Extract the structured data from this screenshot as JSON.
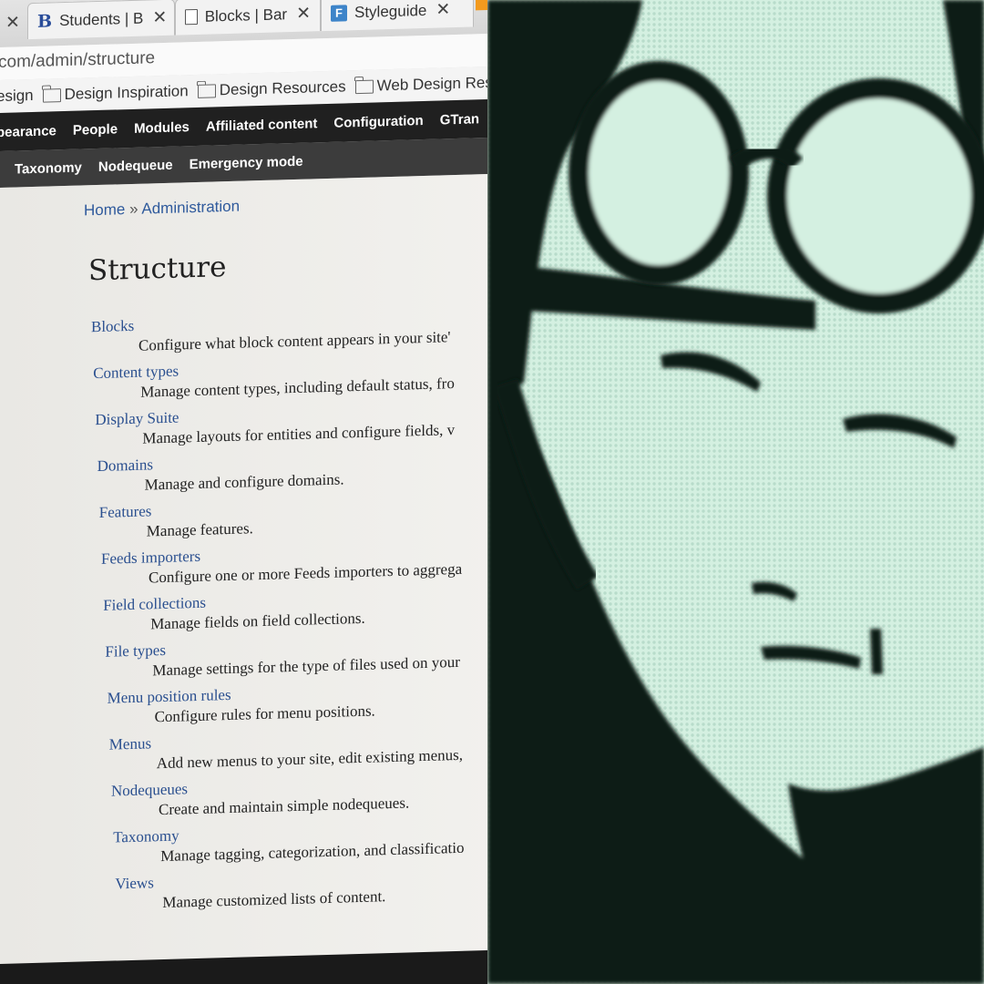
{
  "browser": {
    "tabs": [
      {
        "icon": "b-favicon",
        "label": "Students | B"
      },
      {
        "icon": "document-icon",
        "label": "Blocks | Bar"
      },
      {
        "icon": "styleguide-favicon",
        "label": "Styleguide"
      }
    ],
    "url": "com/admin/structure",
    "bookmarks": [
      {
        "label": "esign",
        "folder": false
      },
      {
        "label": "Design Inspiration",
        "folder": true
      },
      {
        "label": "Design Resources",
        "folder": true
      },
      {
        "label": "Web Design Reso",
        "folder": true
      }
    ]
  },
  "toolbar": {
    "primary": [
      "pearance",
      "People",
      "Modules",
      "Affiliated content",
      "Configuration",
      "GTran"
    ],
    "secondary": [
      "Taxonomy",
      "Nodequeue",
      "Emergency mode"
    ]
  },
  "breadcrumb": {
    "home": "Home",
    "separator": "»",
    "current": "Administration"
  },
  "page_title": "Structure",
  "structure_items": [
    {
      "title": "Blocks",
      "desc": "Configure what block content appears in your site'"
    },
    {
      "title": "Content types",
      "desc": "Manage content types, including default status, fro"
    },
    {
      "title": "Display Suite",
      "desc": "Manage layouts for entities and configure fields, v"
    },
    {
      "title": "Domains",
      "desc": "Manage and configure domains."
    },
    {
      "title": "Features",
      "desc": "Manage features."
    },
    {
      "title": "Feeds importers",
      "desc": "Configure one or more Feeds importers to aggrega"
    },
    {
      "title": "Field collections",
      "desc": "Manage fields on field collections."
    },
    {
      "title": "File types",
      "desc": "Manage settings for the type of files used on your"
    },
    {
      "title": "Menu position rules",
      "desc": "Configure rules for menu positions."
    },
    {
      "title": "Menus",
      "desc": "Add new menus to your site, edit existing menus,"
    },
    {
      "title": "Nodequeues",
      "desc": "Create and maintain simple nodequeues."
    },
    {
      "title": "Taxonomy",
      "desc": "Manage tagging, categorization, and classificatio"
    },
    {
      "title": "Views",
      "desc": "Manage customized lists of content."
    }
  ],
  "colors": {
    "link": "#2a4f8f",
    "toolbar_dark": "#202020",
    "photo_bg": "#cfeadb",
    "photo_ink": "#0d1a18"
  }
}
